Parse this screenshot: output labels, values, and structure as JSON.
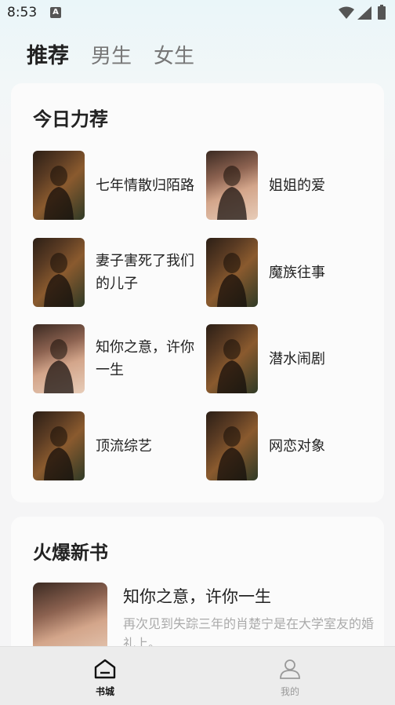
{
  "status_bar": {
    "time": "8:53",
    "notification_icon": "A"
  },
  "tabs": [
    {
      "label": "推荐",
      "active": true
    },
    {
      "label": "男生",
      "active": false
    },
    {
      "label": "女生",
      "active": false
    }
  ],
  "recommend": {
    "title": "今日力荐",
    "books": [
      {
        "title": "七年情散归陌路",
        "cover": "cover-dark"
      },
      {
        "title": "姐姐的爱",
        "cover": "cover-light"
      },
      {
        "title": "妻子害死了我们的儿子",
        "cover": "cover-dark"
      },
      {
        "title": "魔族往事",
        "cover": "cover-dark"
      },
      {
        "title": "知你之意，许你一生",
        "cover": "cover-light"
      },
      {
        "title": "潜水闹剧",
        "cover": "cover-dark"
      },
      {
        "title": "顶流综艺",
        "cover": "cover-dark"
      },
      {
        "title": "网恋对象",
        "cover": "cover-dark"
      }
    ]
  },
  "hot_new": {
    "title": "火爆新书",
    "books": [
      {
        "title": "知你之意，许你一生",
        "desc": "再次见到失踪三年的肖楚宁是在大学室友的婚礼上。...",
        "cover": "cover-light"
      }
    ]
  },
  "bottom_nav": [
    {
      "label": "书城",
      "icon": "bookstore-icon",
      "active": true
    },
    {
      "label": "我的",
      "icon": "profile-icon",
      "active": false
    }
  ]
}
